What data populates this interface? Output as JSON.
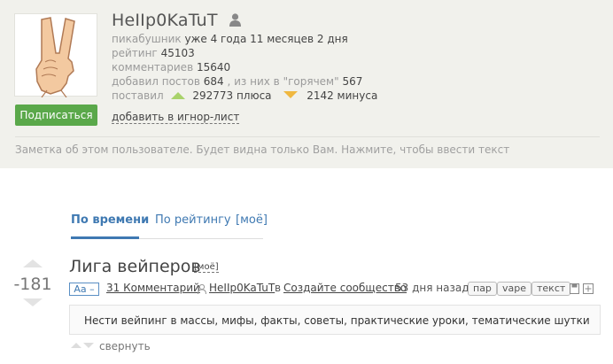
{
  "profile": {
    "username": "HeIIp0KaTuT",
    "member_label": "пикабушник",
    "member_value": "уже 4 года 11 месяцев 2 дня",
    "rating_label": "рейтинг",
    "rating_value": "45103",
    "comments_label": "комментариев",
    "comments_value": "15640",
    "posts_label": "добавил постов",
    "posts_value": "684",
    "hot_label": ", из них в \"горячем\"",
    "hot_value": "567",
    "votes_label": "поставил",
    "plus_value": "292773 плюса",
    "minus_value": "2142 минуса",
    "subscribe_label": "Подписаться",
    "ignore_label": "добавить в игнор-лист",
    "note_placeholder": "Заметка об этом пользователе. Будет видна только Вам. Нажмите, чтобы ввести текст"
  },
  "tabs": [
    {
      "label": "По времени",
      "active": true
    },
    {
      "label": "По рейтингу",
      "active": false
    },
    {
      "label": "[моё]",
      "active": false
    }
  ],
  "community": {
    "rating": "-181",
    "title": "Лига вейперов",
    "moe_label": "[моё]",
    "aa_label": "Аа –",
    "comments_link": "31 Комментарий",
    "author": "HeIIp0KaTuT",
    "in_label": "в",
    "create_link": "Создайте сообщество",
    "ago": "53 дня назад",
    "tags": [
      "пар",
      "vape",
      "текст"
    ],
    "description": "Нести вейпинг в массы, мифы, факты, советы, практические уроки, тематические шутки",
    "fold_label": "свернуть"
  },
  "colors": {
    "profile_bg": "#f1f1ec",
    "subscribe_bg": "#5aa84a",
    "link_blue": "#3f79b2",
    "plus_green": "#a8d26a",
    "minus_orange": "#f0b840"
  }
}
